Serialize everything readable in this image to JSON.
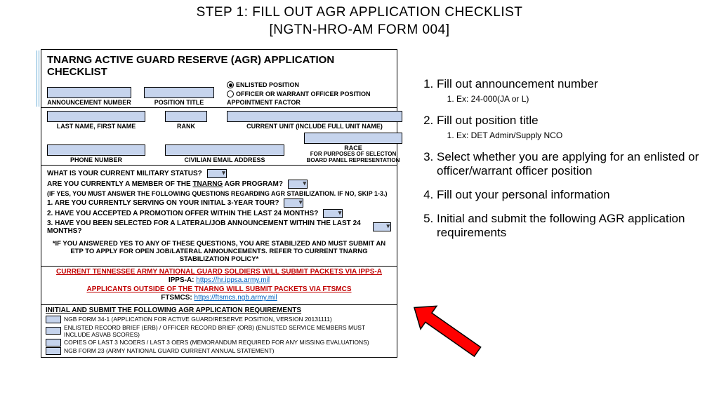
{
  "header": {
    "line1": "STEP 1: FILL OUT AGR APPLICATION CHECKLIST",
    "line2": "[NGTN-HRO-AM FORM 004]"
  },
  "form": {
    "title": "TNARNG ACTIVE GUARD RESERVE (AGR) APPLICATION CHECKLIST",
    "fields": {
      "announcement_number": "ANNOUNCEMENT NUMBER",
      "position_title": "POSITION TITLE",
      "appointment_factor": "APPOINTMENT FACTOR",
      "last_first": "LAST NAME, FIRST NAME",
      "rank": "RANK",
      "current_unit": "CURRENT UNIT (INCLUDE FULL UNIT NAME)",
      "phone": "PHONE NUMBER",
      "email": "CIVILIAN EMAIL ADDRESS",
      "race": "RACE",
      "race_sub": "FOR PURPOSES OF SELECTON BOARD PANEL REPRESENTATION"
    },
    "radios": {
      "enlisted": "ENLISTED POSITION",
      "officer": "OFFICER OR WARRANT OFFICER POSITION"
    },
    "questions": {
      "q_status": "WHAT IS YOUR CURRENT MILITARY STATUS?",
      "q_member": "ARE YOU CURRENTLY A MEMBER OF THE TNARNG AGR PROGRAM?",
      "q_member_underline": "TNARNG",
      "q_note": "(IF YES, YOU MUST ANSWER THE FOLLOWING QUESTIONS REGARDING AGR STABILIZATION. IF NO, SKIP 1-3.)",
      "q1": "1.  ARE YOU CURRENTLY SERVING ON YOUR INITIAL 3-YEAR TOUR?",
      "q2": "2.  HAVE YOU ACCEPTED A PROMOTION OFFER WITHIN THE LAST 24 MONTHS?",
      "q3": "3.  HAVE YOU BEEN SELECTED FOR A LATERAL/JOB ANNOUNCEMENT WITHIN THE LAST 24 MONTHS?",
      "asterisk": "*IF YOU ANSWERED YES TO ANY OF THESE QUESTIONS, YOU ARE STABILIZED AND MUST SUBMIT AN ETP TO APPLY FOR OPEN JOB/LATERAL ANNOUNCEMENTS. REFER TO CURRENT TNARNG STABILIZATION POLICY*"
    },
    "submit": {
      "line1": "CURRENT TENNESSEE ARMY NATIONAL GUARD SOLDIERS WILL SUBMIT PACKETS VIA IPPS-A",
      "ippsa_label": "IPPS-A: ",
      "ippsa_link": "https://hr.ippsa.army.mil",
      "line2": "APPLICANTS OUTSIDE OF THE TNARNG WILL SUBMIT PACKETS VIA FTSMCS",
      "ftsmcs_label": "FTSMCS: ",
      "ftsmcs_link": "https://ftsmcs.ngb.army.mil"
    },
    "reqs": {
      "title": "INITIAL AND SUBMIT THE FOLLOWING AGR APPLICATION REQUIREMENTS",
      "items": [
        "NGB FORM 34-1 (APPLICATION FOR ACTIVE GUARD/RESERVE POSITION, VERSION 20131111)",
        "ENLISTED RECORD BRIEF (ERB) / OFFICER RECORD BRIEF (ORB) (ENLISTED SERVICE MEMBERS MUST INCLUDE ASVAB SCORES)",
        "COPIES OF LAST 3 NCOERS / LAST 3 OERS (MEMORANDUM REQUIRED FOR ANY MISSING EVALUATIONS)",
        "NGB FORM 23 (ARMY NATIONAL GUARD CURRENT ANNUAL STATEMENT)"
      ]
    }
  },
  "instructions": [
    {
      "text": "Fill out announcement number",
      "sub": [
        "Ex: 24-000(JA or L)"
      ]
    },
    {
      "text": "Fill out position title",
      "sub": [
        "Ex: DET Admin/Supply NCO"
      ]
    },
    {
      "text": "Select whether you are applying for an enlisted or officer/warrant officer position",
      "sub": []
    },
    {
      "text": "Fill out your personal information",
      "sub": []
    },
    {
      "text": "Initial and submit the following AGR application requirements",
      "sub": []
    }
  ]
}
